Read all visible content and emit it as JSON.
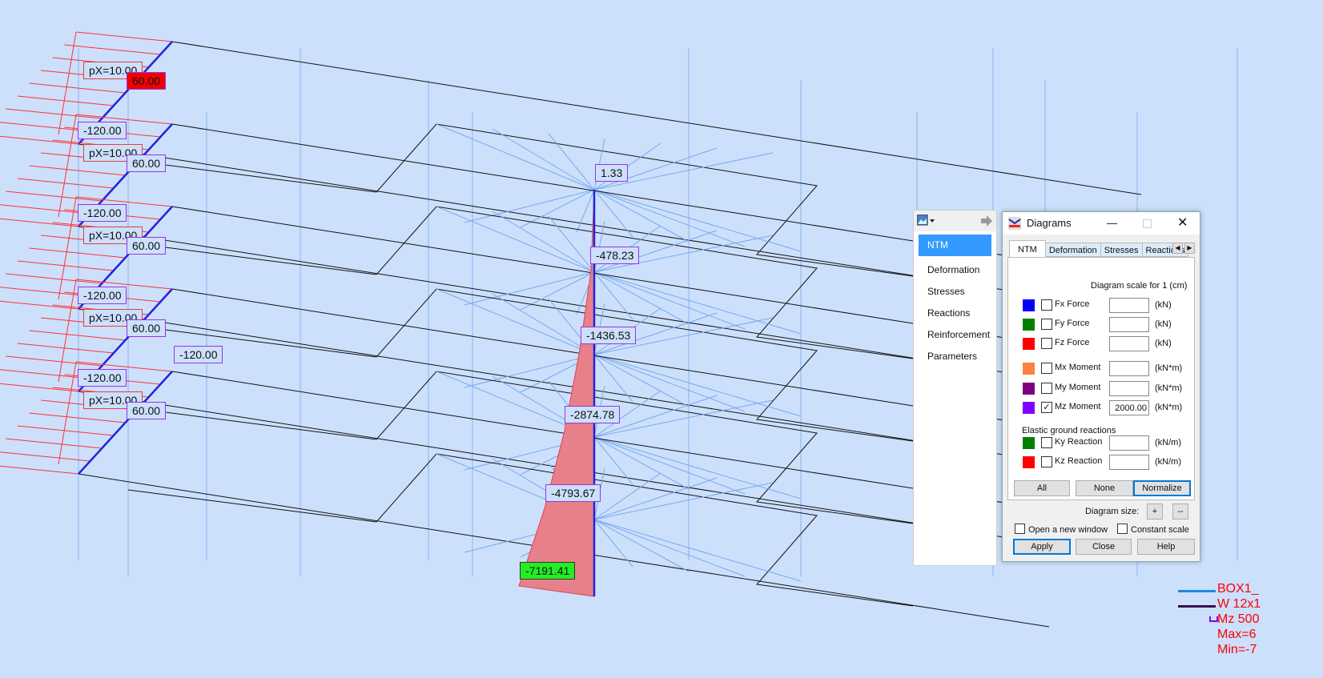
{
  "scene": {
    "column_moment_labels": [
      {
        "text": "1.33",
        "style": "normal"
      },
      {
        "text": "-478.23",
        "style": "normal"
      },
      {
        "text": "-1436.53",
        "style": "normal"
      },
      {
        "text": "-2874.78",
        "style": "normal"
      },
      {
        "text": "-4793.67",
        "style": "normal"
      },
      {
        "text": "-7191.41",
        "style": "green"
      }
    ],
    "beam_labels": {
      "px": "pX=10.00",
      "end": "60.00",
      "start": "-120.00",
      "extra": "-120.00"
    },
    "colors": {
      "background": "#cce0fc",
      "moment_fill": "#e8808c",
      "column": "#2222dd",
      "load": "#ff3333",
      "max_label": "#f20000",
      "min_label": "#22ee22"
    }
  },
  "side_panel": {
    "icon": "image-icon",
    "items": [
      {
        "label": "NTM",
        "active": true
      },
      {
        "label": "Deformation"
      },
      {
        "label": "Stresses"
      },
      {
        "label": "Reactions"
      },
      {
        "label": "Reinforcement"
      },
      {
        "label": "Parameters"
      }
    ]
  },
  "dialog": {
    "title": "Diagrams",
    "tabs": [
      "NTM",
      "Deformation",
      "Stresses",
      "Reactions"
    ],
    "scale_label": "Diagram scale for 1  (cm)",
    "rows": [
      {
        "color": "#0000ff",
        "label": "Fx Force",
        "checked": false,
        "value": "",
        "unit": "(kN)"
      },
      {
        "color": "#008000",
        "label": "Fy Force",
        "checked": false,
        "value": "",
        "unit": "(kN)"
      },
      {
        "color": "#ff0000",
        "label": "Fz Force",
        "checked": false,
        "value": "",
        "unit": "(kN)"
      },
      {
        "color": "#ff8040",
        "label": "Mx Moment",
        "checked": false,
        "value": "",
        "unit": "(kN*m)"
      },
      {
        "color": "#800080",
        "label": "My Moment",
        "checked": false,
        "value": "",
        "unit": "(kN*m)"
      },
      {
        "color": "#8000ff",
        "label": "Mz Moment",
        "checked": true,
        "value": "2000.00",
        "unit": "(kN*m)"
      }
    ],
    "ground_label": "Elastic ground reactions",
    "ground_rows": [
      {
        "color": "#008000",
        "label": "Ky Reaction",
        "checked": false,
        "value": "",
        "unit": "(kN/m)"
      },
      {
        "color": "#ff0000",
        "label": "Kz Reaction",
        "checked": false,
        "value": "",
        "unit": "(kN/m)"
      }
    ],
    "btn_all": "All",
    "btn_none": "None",
    "btn_normalize": "Normalize",
    "size_label": "Diagram size:",
    "btn_plus": "+",
    "btn_minus": "--",
    "open_new_window": "Open a new window",
    "constant_scale": "Constant scale",
    "btn_apply": "Apply",
    "btn_close": "Close",
    "btn_help": "Help"
  },
  "legend": [
    {
      "text": "BOX1_",
      "swatch": "#1e88e5"
    },
    {
      "text": "W 12x1",
      "swatch": "#3a0a4a"
    },
    {
      "text": "Mz  500",
      "swatch": "#8000ff"
    },
    {
      "text": "Max=6"
    },
    {
      "text": "Min=-7"
    }
  ]
}
